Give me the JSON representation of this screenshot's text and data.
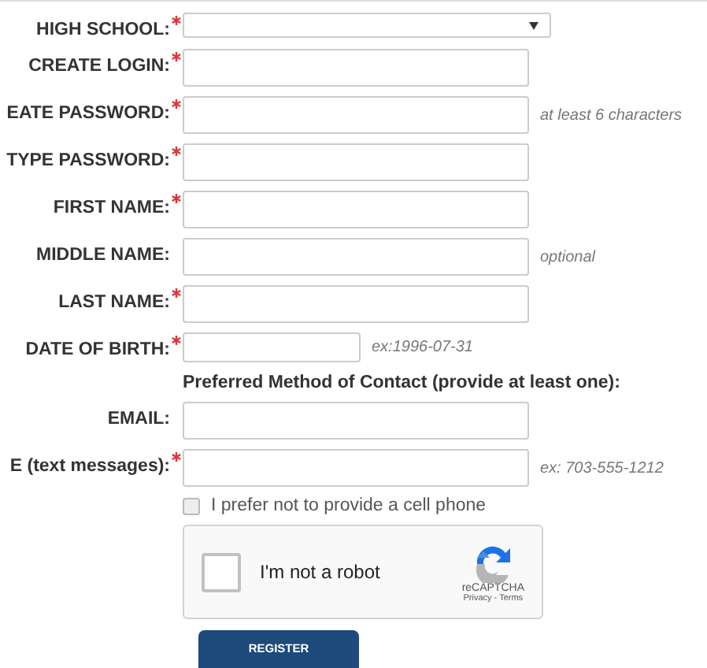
{
  "fields": [
    {
      "kind": "select",
      "label": "HIGH SCHOOL:",
      "required": true
    },
    {
      "kind": "text",
      "label": "CREATE LOGIN:",
      "required": true
    },
    {
      "kind": "text",
      "label": "EATE PASSWORD:",
      "required": true,
      "hint": "at least 6 characters"
    },
    {
      "kind": "text",
      "label": "TYPE PASSWORD:",
      "required": true
    },
    {
      "kind": "text",
      "label": "FIRST NAME:",
      "required": true
    },
    {
      "kind": "text",
      "label": "MIDDLE NAME:",
      "required": false,
      "hint": "optional"
    },
    {
      "kind": "text",
      "label": "LAST NAME:",
      "required": true
    },
    {
      "kind": "short",
      "label": "DATE OF BIRTH:",
      "required": true,
      "hint": "ex:1996-07-31"
    },
    {
      "kind": "heading",
      "text": "Preferred Method of Contact (provide at least one):"
    },
    {
      "kind": "text",
      "label": "EMAIL:",
      "required": false
    },
    {
      "kind": "text",
      "label": "E (text messages):",
      "required": true,
      "hint": "ex: 703-555-1212"
    },
    {
      "kind": "checkbox",
      "text": "I prefer not to provide a cell phone",
      "checked": false
    }
  ],
  "captcha": {
    "text": "I'm not a robot",
    "checked": false,
    "brand": "reCAPTCHA",
    "links": "Privacy - Terms"
  },
  "submit": "REGISTER"
}
